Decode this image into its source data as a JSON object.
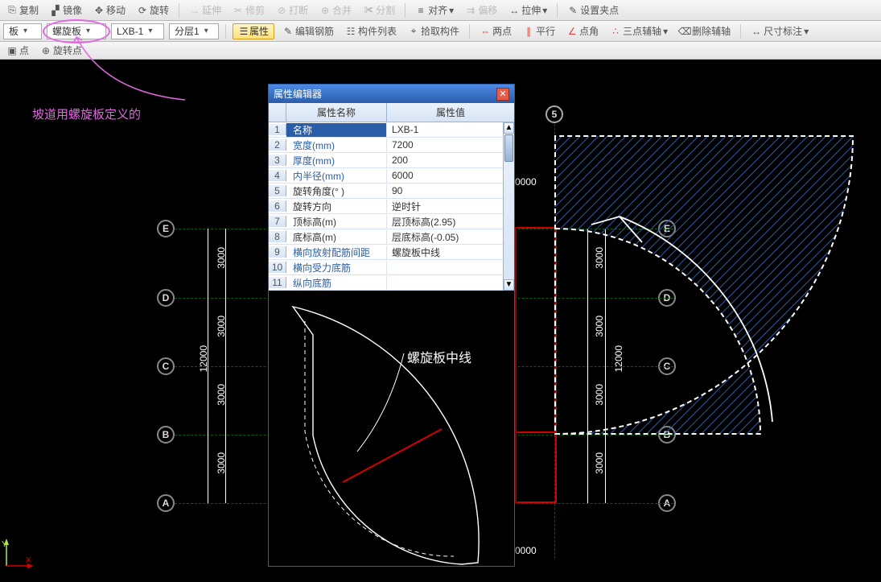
{
  "toolbar1": {
    "copy": "复制",
    "mirror": "镜像",
    "move": "移动",
    "rotate": "旋转",
    "extend": "延伸",
    "trim": "修剪",
    "break": "打断",
    "merge": "合并",
    "split": "分割",
    "align": "对齐",
    "offset": "偏移",
    "stretch": "拉伸",
    "setbase": "设置夹点"
  },
  "toolbar2": {
    "combo1": "板",
    "combo2": "螺旋板",
    "combo3": "LXB-1",
    "combo4": "分层1",
    "attr": "属性",
    "editrebar": "编辑钢筋",
    "complist": "构件列表",
    "pickcomp": "拾取构件",
    "twopt": "两点",
    "parallel": "平行",
    "ptangle": "点角",
    "triaux": "三点辅轴",
    "delaux": "删除辅轴",
    "dimmark": "尺寸标注"
  },
  "toolbar3": {
    "point": "点",
    "rotpoint": "旋转点"
  },
  "note": "坡道用螺旋板定义的",
  "dialog": {
    "title": "属性编辑器",
    "headName": "属性名称",
    "headVal": "属性值",
    "rows": [
      {
        "i": "1",
        "n": "名称",
        "v": "LXB-1",
        "sel": true
      },
      {
        "i": "2",
        "n": "宽度(mm)",
        "v": "7200"
      },
      {
        "i": "3",
        "n": "厚度(mm)",
        "v": "200"
      },
      {
        "i": "4",
        "n": "内半径(mm)",
        "v": "6000"
      },
      {
        "i": "5",
        "n": "旋转角度(° )",
        "v": "90",
        "black": true
      },
      {
        "i": "6",
        "n": "旋转方向",
        "v": "逆时针",
        "black": true
      },
      {
        "i": "7",
        "n": "顶标高(m)",
        "v": "层顶标高(2.95)",
        "black": true
      },
      {
        "i": "8",
        "n": "底标高(m)",
        "v": "层底标高(-0.05)",
        "black": true
      },
      {
        "i": "9",
        "n": "横向放射配筋间距",
        "v": "螺旋板中线"
      },
      {
        "i": "10",
        "n": "横向受力底筋",
        "v": ""
      },
      {
        "i": "11",
        "n": "纵向底筋",
        "v": ""
      }
    ],
    "previewLabel": "螺旋板中线"
  },
  "bubbles": {
    "left": [
      "E",
      "D",
      "C",
      "B",
      "A"
    ],
    "right": [
      "E",
      "D",
      "C",
      "B",
      "A"
    ],
    "top": "5"
  },
  "dims": {
    "v": [
      "3000",
      "3000",
      "3000",
      "3000"
    ],
    "big": "12000",
    "h1": "0000",
    "h2": "0000"
  },
  "ucs": {
    "y": "Y",
    "x": "X"
  }
}
